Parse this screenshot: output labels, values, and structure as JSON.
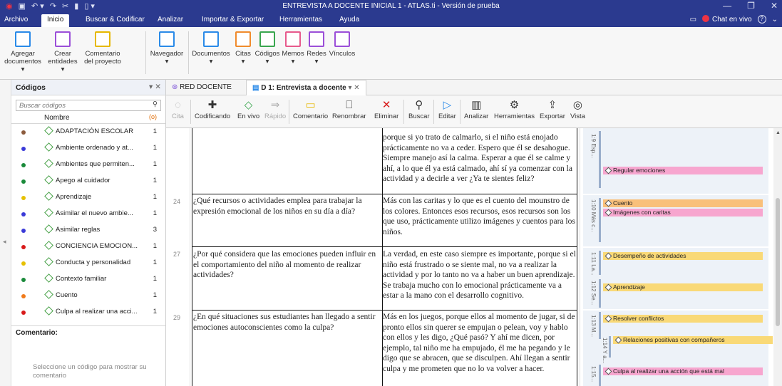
{
  "window": {
    "title": "ENTREVISTA A DOCENTE INICIAL 1 - ATLAS.ti - Versión de prueba",
    "controls": [
      "—",
      "❐",
      "✕"
    ]
  },
  "menubar": {
    "items": [
      "Archivo",
      "Inicio",
      "Buscar & Codificar",
      "Analizar",
      "Importar & Exportar",
      "Herramientas",
      "Ayuda"
    ],
    "active": "Inicio",
    "chat": "Chat en vivo",
    "help": "?"
  },
  "ribbon": {
    "agregar": "Agregar documentos ▾",
    "crear": "Crear entidades ▾",
    "comentario": "Comentario del proyecto",
    "navegador": "Navegador",
    "documentos": "Documentos",
    "citas": "Citas",
    "codigos": "Códigos",
    "memos": "Memos",
    "redes": "Redes",
    "vinculos": "Vínculos",
    "arrow": "▾"
  },
  "codes_panel": {
    "title": "Códigos",
    "search_placeholder": "Buscar códigos",
    "col_name": "Nombre",
    "col_count_icon": "(o)",
    "items": [
      {
        "label": "ADAPTACIÓN ESCOLAR",
        "count": "1",
        "color": "#8b5a3c"
      },
      {
        "label": "Ambiente ordenado y at...",
        "count": "1",
        "color": "#3a3ad8"
      },
      {
        "label": "Ambientes que permiten...",
        "count": "1",
        "color": "#1a8a3a"
      },
      {
        "label": "Apego al cuidador",
        "count": "1",
        "color": "#1a8a3a"
      },
      {
        "label": "Aprendizaje",
        "count": "1",
        "color": "#e6c000"
      },
      {
        "label": "Asimilar el nuevo ambie...",
        "count": "1",
        "color": "#3a3ad8"
      },
      {
        "label": "Asimilar reglas",
        "count": "3",
        "color": "#3a3ad8"
      },
      {
        "label": "CONCIENCIA EMOCION...",
        "count": "1",
        "color": "#d81a1a"
      },
      {
        "label": "Conducta y personalidad",
        "count": "1",
        "color": "#e6c000"
      },
      {
        "label": "Contexto familiar",
        "count": "1",
        "color": "#1a8a3a"
      },
      {
        "label": "Cuento",
        "count": "1",
        "color": "#f07a1a"
      },
      {
        "label": "Culpa al realizar una acci...",
        "count": "1",
        "color": "#d81a1a"
      }
    ],
    "comentario_label": "Comentario:",
    "comentario_placeholder": "Seleccione un código para mostrar su comentario"
  },
  "tabs": {
    "red": "RED DOCENTE",
    "doc": "D 1: Entrevista a docente",
    "doc_ctl": "▾ ✕"
  },
  "toolbar": {
    "cita": "Cita",
    "codificando": "Codificando",
    "envivo": "En vivo",
    "rapido": "Rápido",
    "comentario": "Comentario",
    "renombrar": "Renombrar",
    "eliminar": "Eliminar",
    "buscar": "Buscar",
    "editar": "Editar",
    "analizar": "Analizar",
    "herramientas": "Herramientas",
    "exportar": "Exportar",
    "vista": "Vista"
  },
  "document": {
    "rows": [
      {
        "num": "",
        "q": "",
        "a": "porque si yo trato de calmarlo, si el niño está enojado prácticamente no va a ceder. Espero que él se desahogue. Siempre manejo así la calma. Esperar a que él se calme y ahí, a lo que él ya está calmado, ahí sí ya comenzar con la actividad y a decirle a ver ¿Ya te sientes feliz?"
      },
      {
        "num": "24",
        "q": "¿Qué recursos o actividades emplea para trabajar la expresión emocional de los niños en su día a día?",
        "a": "Más con las caritas y lo que es el cuento del mounstro de los colores. Entonces esos recursos, esos recursos son los que uso, prácticamente utilizo imágenes y cuentos para los niños."
      },
      {
        "num": "27",
        "q": "¿Por qué considera que las emociones pueden influir en el comportamiento del niño al momento de realizar actividades?",
        "a": "La verdad, en este caso siempre es importante, porque si el niño está frustrado o se siente mal, no va a realizar la actividad y por lo tanto no va a haber un buen aprendizaje. Se trabaja mucho con lo emocional prácticamente va a estar a la mano con el desarrollo cognitivo."
      },
      {
        "num": "29",
        "q": "¿En qué situaciones sus estudiantes han llegado a sentir emociones autoconscientes como la culpa?",
        "a": "Más en los juegos, porque ellos al momento de jugar, si de pronto ellos sin querer se empujan o pelean, voy y hablo con ellos y les digo, ¿Qué pasó? Y ahí me dicen, por ejemplo, tal niño me ha empujado, él me ha pegando y le digo que se abracen, que se disculpen. Ahí llegan a sentir culpa y me prometen que no lo va volver a hacer."
      }
    ]
  },
  "margin": {
    "quotes": [
      "1:9 Esp...",
      "1:10 Más c...",
      "1:11 La...",
      "1:12 Se...",
      "1:13 M...",
      "1:14 Y a...",
      "1:15..."
    ],
    "codes": [
      {
        "label": "Regular emociones",
        "color": "#f7a6cf"
      },
      {
        "label": "Cuento",
        "color": "#f9c07a"
      },
      {
        "label": "Imágenes con caritas",
        "color": "#f7a6cf"
      },
      {
        "label": "Desempeño de actividades",
        "color": "#f9d977"
      },
      {
        "label": "Aprendizaje",
        "color": "#f9d977"
      },
      {
        "label": "Resolver conflictos",
        "color": "#f9d977"
      },
      {
        "label": "Relaciones positivas con compañeros",
        "color": "#f9d977"
      },
      {
        "label": "Culpa al realizar una acción que está mal",
        "color": "#f7a6cf"
      }
    ]
  }
}
